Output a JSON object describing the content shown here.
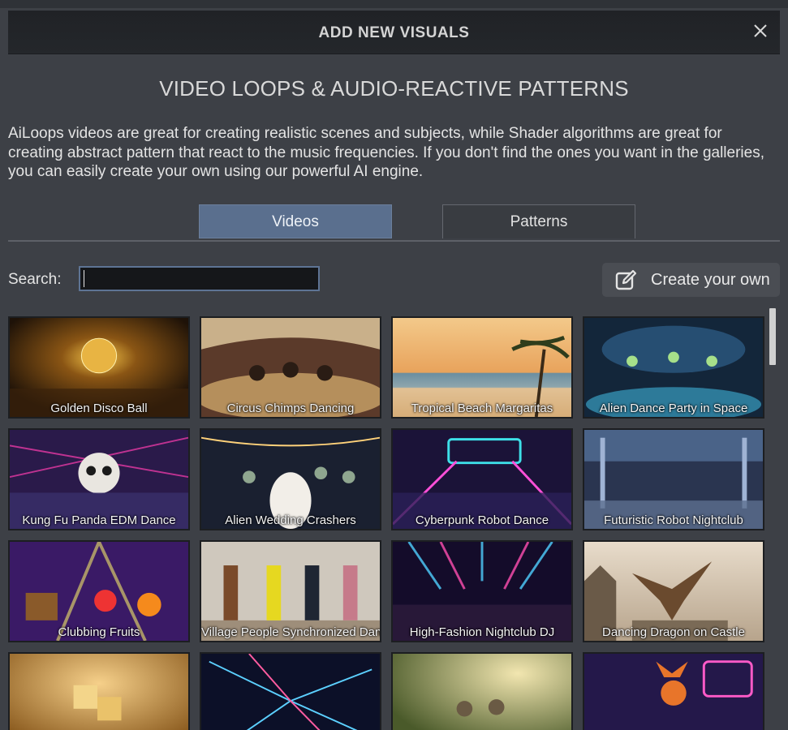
{
  "dialog": {
    "title": "ADD NEW VISUALS",
    "close_icon": "close-icon"
  },
  "subtitle": "VIDEO LOOPS & AUDIO-REACTIVE PATTERNS",
  "description": "AiLoops videos are great for creating realistic scenes and subjects, while Shader algorithms are great for creating abstract pattern that react to the music frequencies. If you don't find the ones you want in the galleries, you can easily create your own using our powerful AI engine.",
  "tabs": [
    {
      "label": "Videos",
      "selected": true
    },
    {
      "label": "Patterns",
      "selected": false
    }
  ],
  "search": {
    "label": "Search:",
    "value": ""
  },
  "create_button": {
    "label": "Create your own",
    "icon": "edit-icon"
  },
  "colors": {
    "accent_tab": "#5a6f8e",
    "search_border": "#5e7494",
    "background": "#3d4046"
  },
  "gallery": {
    "items": [
      {
        "caption": "Golden Disco Ball"
      },
      {
        "caption": "Circus Chimps Dancing"
      },
      {
        "caption": "Tropical Beach Margaritas"
      },
      {
        "caption": "Alien Dance Party in Space"
      },
      {
        "caption": "Kung Fu Panda EDM Dance"
      },
      {
        "caption": "Alien Wedding Crashers"
      },
      {
        "caption": "Cyberpunk Robot Dance"
      },
      {
        "caption": "Futuristic Robot Nightclub"
      },
      {
        "caption": "Clubbing Fruits"
      },
      {
        "caption": "Village People Synchronized Dance"
      },
      {
        "caption": "High-Fashion Nightclub DJ"
      },
      {
        "caption": "Dancing Dragon on Castle"
      },
      {
        "caption": ""
      },
      {
        "caption": ""
      },
      {
        "caption": ""
      },
      {
        "caption": ""
      }
    ]
  }
}
